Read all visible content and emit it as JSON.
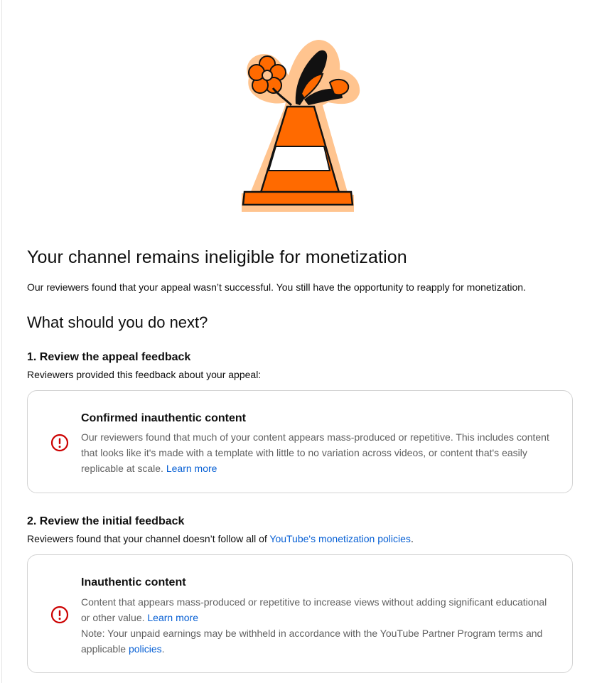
{
  "header": {
    "title": "Your channel remains ineligible for monetization",
    "subtitle": "Our reviewers found that your appeal wasn’t successful. You still have the opportunity to reapply for monetization."
  },
  "next_steps": {
    "heading": "What should you do next?"
  },
  "step1": {
    "title": "1. Review the appeal feedback",
    "description": "Reviewers provided this feedback about your appeal:",
    "card": {
      "icon": "alert-circle-icon",
      "title": "Confirmed inauthentic content",
      "body": "Our reviewers found that much of your content appears mass-produced or repetitive. This includes content that looks like it's made with a template with little to no variation across videos, or content that's easily replicable at scale.",
      "learn_more": "Learn more"
    }
  },
  "step2": {
    "title": "2. Review the initial feedback",
    "description_before": "Reviewers found that your channel doesn’t follow all of ",
    "description_link": "YouTube's monetization policies",
    "description_after": ".",
    "card": {
      "icon": "alert-circle-icon",
      "title": "Inauthentic content",
      "body": "Content that appears mass-produced or repetitive to increase views without adding significant educational or other value.",
      "learn_more": "Learn more",
      "note_before": "Note: Your unpaid earnings may be withheld in accordance with the YouTube Partner Program terms and applicable ",
      "note_link": "policies",
      "note_after": "."
    }
  },
  "colors": {
    "accent_link": "#065fd4",
    "error_red": "#cc0000",
    "cone_orange": "#ff6a00",
    "cone_halo": "#ffc48f"
  }
}
